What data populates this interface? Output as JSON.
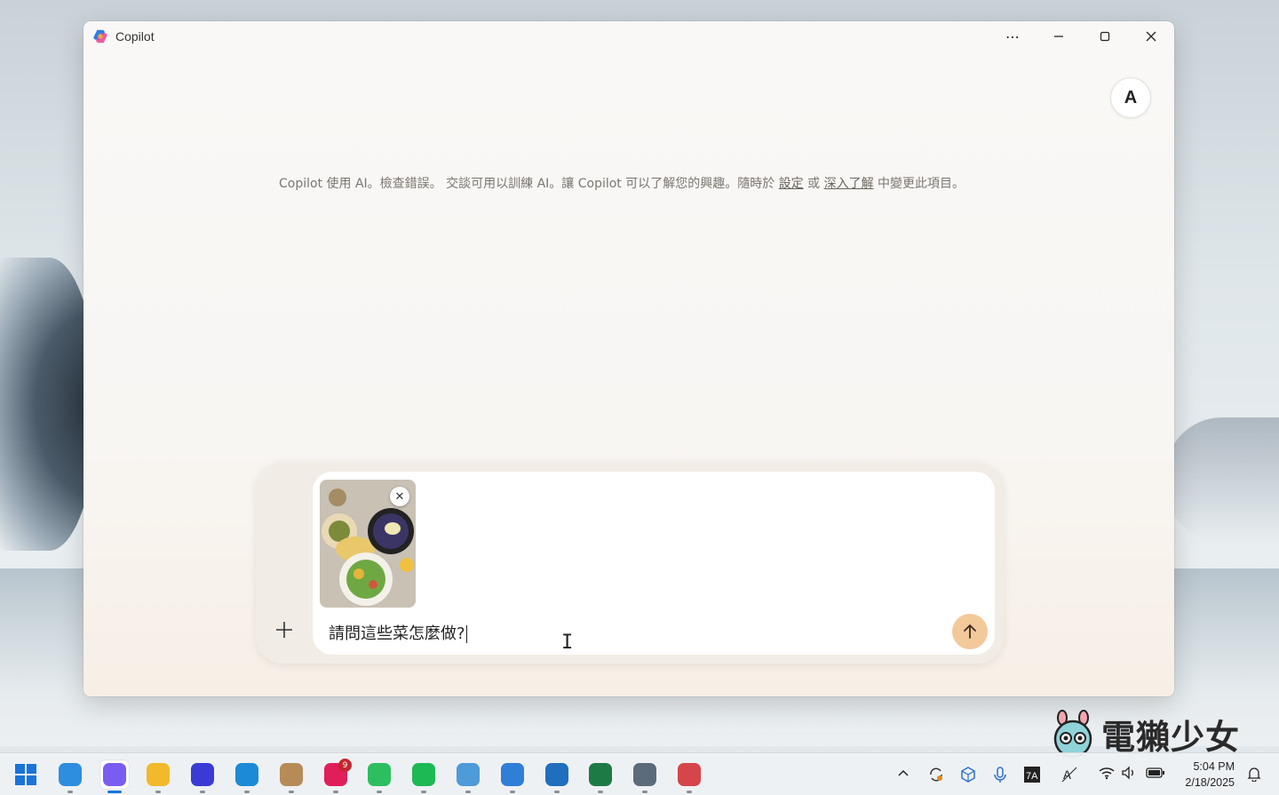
{
  "window": {
    "title": "Copilot",
    "controls": {
      "more": "⋯",
      "minimize": "—",
      "maximize": "☐",
      "close": "✕"
    }
  },
  "avatar": {
    "initial": "A"
  },
  "notice": {
    "text_before": "Copilot 使用 AI。檢查錯誤。 交談可用以訓練 AI。讓 Copilot 可以了解您的興趣。隨時於 ",
    "link_settings": "設定",
    "text_middle": " 或 ",
    "link_learn_more": "深入了解",
    "text_after": " 中變更此項目。"
  },
  "composer": {
    "attach_label": "+",
    "attachment": {
      "remove_label": "✕",
      "kind": "food photo"
    },
    "input_value": "請問這些菜怎麼做?",
    "send_icon": "arrow-up-icon"
  },
  "watermark": {
    "text": "電獺少女"
  },
  "taskbar": {
    "apps": [
      {
        "name": "start",
        "color": "#1a73d9"
      },
      {
        "name": "weather",
        "color": "#2d8ee0"
      },
      {
        "name": "copilot",
        "color": "#7b5cf0",
        "active": true
      },
      {
        "name": "file-explorer",
        "color": "#f2b92b"
      },
      {
        "name": "notion-like",
        "color": "#3a3ad6"
      },
      {
        "name": "edge",
        "color": "#1c8ad6"
      },
      {
        "name": "app-box",
        "color": "#b78b58"
      },
      {
        "name": "slack",
        "color": "#e01e5a",
        "badge": "9"
      },
      {
        "name": "evernote",
        "color": "#2dbe60"
      },
      {
        "name": "spotify",
        "color": "#1db954"
      },
      {
        "name": "paint",
        "color": "#4f9ad8"
      },
      {
        "name": "photos-edit",
        "color": "#2f7ed8"
      },
      {
        "name": "photos",
        "color": "#1f6fbe"
      },
      {
        "name": "excel",
        "color": "#1d7a45"
      },
      {
        "name": "settings",
        "color": "#5b6b7b"
      },
      {
        "name": "snipping-tool",
        "color": "#d6454a"
      }
    ],
    "tray": {
      "chevron": "^",
      "time": "5:04 PM",
      "date": "2/18/2025"
    }
  }
}
